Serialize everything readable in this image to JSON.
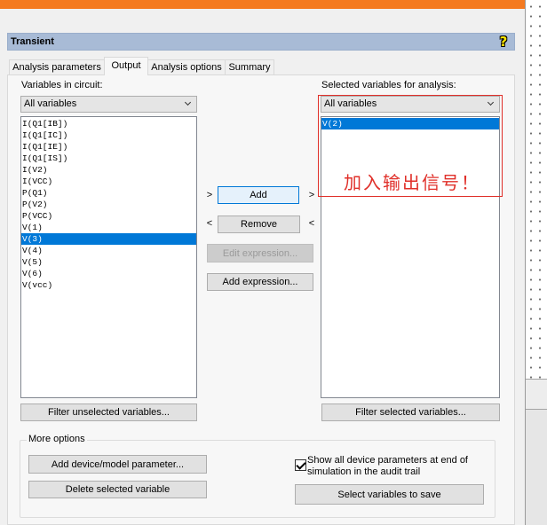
{
  "dialog": {
    "title": "Transient",
    "help_icon": "help-question-icon"
  },
  "tabs": [
    {
      "label": "Analysis parameters",
      "selected": false
    },
    {
      "label": "Output",
      "selected": true
    },
    {
      "label": "Analysis options",
      "selected": false
    },
    {
      "label": "Summary",
      "selected": false
    }
  ],
  "circuit_variables": {
    "label": "Variables in circuit:",
    "filter_value": "All variables",
    "items": [
      {
        "label": "I(Q1[IB])",
        "selected": false
      },
      {
        "label": "I(Q1[IC])",
        "selected": false
      },
      {
        "label": "I(Q1[IE])",
        "selected": false
      },
      {
        "label": "I(Q1[IS])",
        "selected": false
      },
      {
        "label": "I(V2)",
        "selected": false
      },
      {
        "label": "I(VCC)",
        "selected": false
      },
      {
        "label": "P(Q1)",
        "selected": false
      },
      {
        "label": "P(V2)",
        "selected": false
      },
      {
        "label": "P(VCC)",
        "selected": false
      },
      {
        "label": "V(1)",
        "selected": false
      },
      {
        "label": "V(3)",
        "selected": true
      },
      {
        "label": "V(4)",
        "selected": false
      },
      {
        "label": "V(5)",
        "selected": false
      },
      {
        "label": "V(6)",
        "selected": false
      },
      {
        "label": "V(vcc)",
        "selected": false
      }
    ],
    "filter_button": "Filter unselected variables..."
  },
  "transfer": {
    "add_arrow": ">",
    "remove_arrow": "<",
    "add_label": "Add",
    "remove_label": "Remove",
    "edit_expression_label": "Edit expression...",
    "edit_expression_enabled": false,
    "add_expression_label": "Add expression..."
  },
  "selected_variables": {
    "label": "Selected variables for analysis:",
    "filter_value": "All variables",
    "items": [
      {
        "label": "V(2)",
        "selected": true
      }
    ],
    "filter_button": "Filter selected variables..."
  },
  "more_options": {
    "legend": "More options",
    "add_device_label": "Add device/model parameter...",
    "delete_label": "Delete selected variable",
    "show_device_params": {
      "checked": true,
      "label_line1": "Show all device parameters at end of",
      "label_line2": "simulation in the audit trail"
    },
    "select_save_label": "Select variables to save"
  },
  "annotation": {
    "text": "加入输出信号！"
  },
  "colors": {
    "accent": "#0078d7",
    "annotation": "#e0302a",
    "window_accent": "#f47a20",
    "title_bar": "#a8bbd6"
  }
}
